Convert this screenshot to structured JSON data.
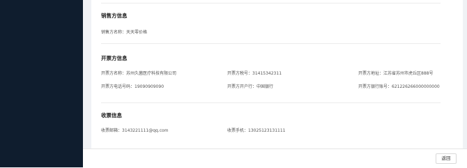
{
  "seller": {
    "title": "销售方信息",
    "name_label": "销售方名称：",
    "name_value": "天天零价格"
  },
  "invoice": {
    "title": "开票方信息",
    "company_label": "开票方名称：",
    "company_value": "苏州久菌医疗科技有限公司",
    "tax_label": "开票方税号：",
    "tax_value": "31415342311",
    "address_label": "开票方地址：",
    "address_value": "江苏省苏州市虎丘区888号",
    "phone_label": "开票方电话号码：",
    "phone_value": "19090909090",
    "bank_label": "开票方开户行：",
    "bank_value": "中国银行",
    "account_label": "开票方银行账号：",
    "account_value": "621226266000000000"
  },
  "receiver": {
    "title": "收票信息",
    "email_label": "收票邮箱：",
    "email_value": "3143221111@qq.com",
    "phone_label": "收票手机：",
    "phone_value": "13025123131111"
  },
  "footer": {
    "back_label": "返回"
  }
}
